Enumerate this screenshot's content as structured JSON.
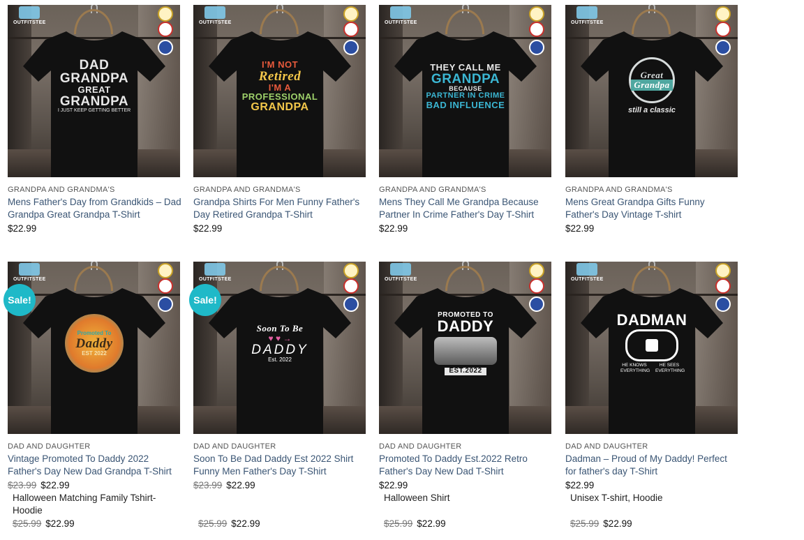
{
  "products": [
    {
      "category": "GRANDPA AND GRANDMA'S",
      "title": "Mens Father's Day from Grandkids – Dad Grandpa Great Grandpa T-Shirt",
      "price": "$22.99",
      "design": {
        "l1": "DAD",
        "l2": "GRANDPA",
        "l3": "GREAT",
        "l4": "GRANDPA",
        "l5": "I JUST KEEP GETTING BETTER"
      },
      "colors": {
        "primary": "#e8e8e8",
        "accent": "#e8e8e8"
      }
    },
    {
      "category": "GRANDPA AND GRANDMA'S",
      "title": "Grandpa Shirts For Men Funny Father's Day Retired Grandpa T-Shirt",
      "price": "$22.99",
      "design": {
        "l1": "I'M NOT",
        "l2": "Retired",
        "l3": "I'M A",
        "l4": "PROFESSIONAL",
        "l5": "GRANDPA"
      },
      "colors": {
        "primary": "#f3c64a",
        "accent": "#9ed06a"
      }
    },
    {
      "category": "GRANDPA AND GRANDMA'S",
      "title": "Mens They Call Me Grandpa Because Partner In Crime Father's Day T-Shirt",
      "price": "$22.99",
      "design": {
        "l1": "THEY CALL ME",
        "l2": "GRANDPA",
        "l3": "BECAUSE",
        "l4": "PARTNER IN CRIME",
        "l5": "BAD INFLUENCE"
      },
      "colors": {
        "primary": "#3bb6d3",
        "accent": "#e8e8e8"
      }
    },
    {
      "category": "GRANDPA AND GRANDMA'S",
      "title": "Mens Great Grandpa Gifts Funny Father's Day Vintage T-shirt",
      "price": "$22.99",
      "design": {
        "l1": "Great",
        "l2": "Grandpa",
        "l3": "still a classic",
        "l4": "",
        "l5": ""
      },
      "colors": {
        "primary": "#d7dcdc",
        "accent": "#4fa7a0"
      }
    },
    {
      "category": "DAD AND DAUGHTER",
      "title": "Vintage Promoted To Daddy 2022 Father's Day New Dad Grandpa T-Shirt",
      "old_price": "$23.99",
      "price": "$22.99",
      "sale": "Sale!",
      "extra_title": "Halloween Matching Family Tshirt-Hoodie",
      "extra_old_price": "$25.99",
      "extra_price": "$22.99",
      "design": {
        "l1": "Promoted To",
        "l2": "Daddy",
        "l3": "EST 2022",
        "l4": "",
        "l5": ""
      },
      "colors": {
        "primary": "#f0b33a",
        "accent": "#2fa8a8"
      }
    },
    {
      "category": "DAD AND DAUGHTER",
      "title": "Soon To Be Dad Daddy Est 2022 Shirt Funny Men Father's Day T-Shirt",
      "old_price": "$23.99",
      "price": "$22.99",
      "sale": "Sale!",
      "extra_title": "",
      "extra_old_price": "$25.99",
      "extra_price": "$22.99",
      "design": {
        "l1": "Soon To Be",
        "l2": "DADDY",
        "l3": "Est. 2022",
        "l4": "",
        "l5": ""
      },
      "colors": {
        "primary": "#ffffff",
        "accent": "#e45fa3"
      }
    },
    {
      "category": "DAD AND DAUGHTER",
      "title": "Promoted To Daddy Est.2022 Retro Father's Day New Dad T-Shirt",
      "price": "$22.99",
      "extra_title": "Halloween Shirt",
      "extra_old_price": "$25.99",
      "extra_price": "$22.99",
      "design": {
        "l1": "PROMOTED TO",
        "l2": "DADDY",
        "l3": "EST.2022",
        "l4": "",
        "l5": ""
      },
      "colors": {
        "primary": "#ffffff",
        "accent": "#bdbdbd"
      }
    },
    {
      "category": "DAD AND DAUGHTER",
      "title": "Dadman – Proud of My Daddy! Perfect for father's day T-Shirt",
      "price": "$22.99",
      "extra_title": "Unisex T-shirt, Hoodie",
      "extra_old_price": "$25.99",
      "extra_price": "$22.99",
      "design": {
        "l1": "DADMAN",
        "l2": "",
        "l3": "HE KNOWS EVERYTHING",
        "l4": "HE SEES EVERYTHING",
        "l5": ""
      },
      "colors": {
        "primary": "#ffffff",
        "accent": "#ffffff"
      }
    }
  ],
  "brand": {
    "name": "OUTFITSTEE"
  }
}
